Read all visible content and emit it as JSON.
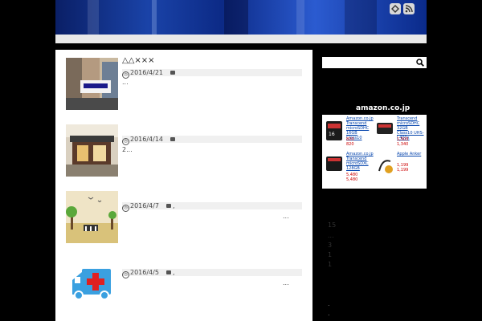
{
  "header": {
    "icons": [
      "feedly-icon",
      "rss-icon"
    ]
  },
  "posts": [
    {
      "title": "△△×××",
      "date": "2016/4/21",
      "category": "",
      "excerpt": "..."
    },
    {
      "title": "",
      "date": "2016/4/14",
      "category": "",
      "excerpt": "2..."
    },
    {
      "title": "",
      "date": "2016/4/7",
      "category": ",",
      "excerpt": "..."
    },
    {
      "title": "",
      "date": "2016/4/5",
      "category": ",",
      "excerpt": "..."
    }
  ],
  "sidebar": {
    "search_placeholder": "",
    "amazon": {
      "logo": "amazon.co.jp",
      "products": [
        {
          "name": "Amazon.co.jp Transcend microSDHC 16GB Class10",
          "price": "820",
          "price2": "820"
        },
        {
          "name": "Transcend microSDHC 32GB Class10 UHS-I 400x",
          "price": "1,503",
          "price2": "1,340"
        },
        {
          "name": "Amazon.co.jp Transcend microSDXC 128GB",
          "price": "5,480",
          "price2": "5,480"
        },
        {
          "name": "Apple Anker",
          "price": "1,199",
          "price2": "1,199"
        }
      ]
    },
    "links": [
      "15",
      "...",
      "3",
      "1",
      "1"
    ]
  }
}
